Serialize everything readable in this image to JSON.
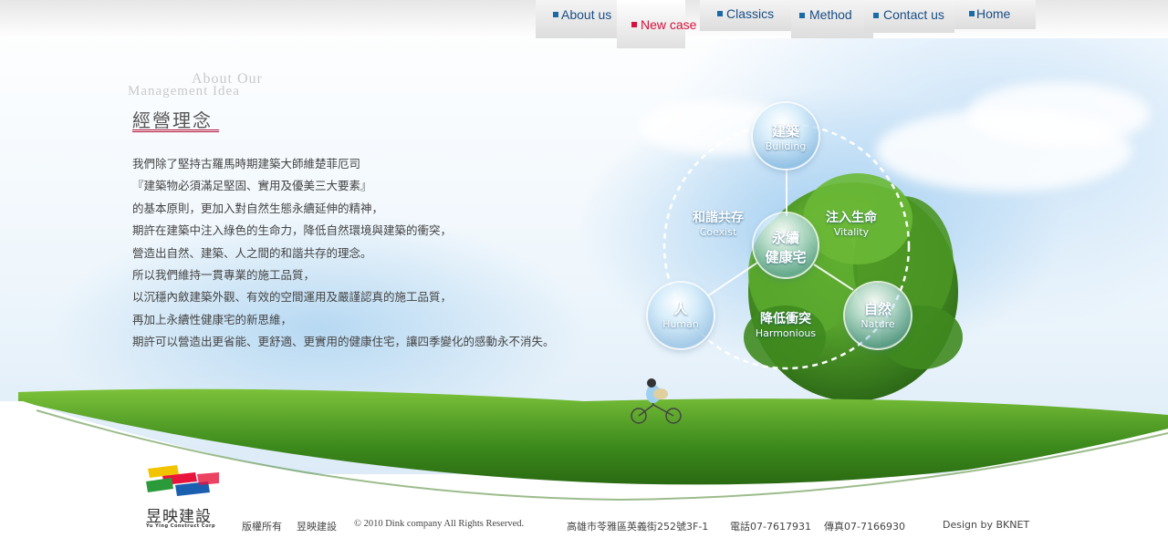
{
  "nav": {
    "items": [
      {
        "label": "About us",
        "active": false
      },
      {
        "label": "New case",
        "active": true
      },
      {
        "label": "Classics",
        "active": false
      },
      {
        "label": "Method",
        "active": false
      },
      {
        "label": "Contact us",
        "active": false
      },
      {
        "label": "Home",
        "active": false
      }
    ],
    "accent_color": "#1a6aa8",
    "active_color": "#d8103a"
  },
  "section": {
    "heading_en_line1": "About Our",
    "heading_en_line2": "Management Idea",
    "heading_zh": "經營理念"
  },
  "body": {
    "lines": [
      "我們除了堅持古羅馬時期建築大師維楚菲厄司",
      "『建築物必須滿足堅固、實用及優美三大要素』",
      "的基本原則，更加入對自然生態永續延伸的精神，",
      "期許在建築中注入綠色的生命力，降低自然環境與建築的衝突，",
      "營造出自然、建築、人之間的和諧共存的理念。",
      "所以我們維持一貫專業的施工品質，",
      "以沉穩內斂建築外觀、有效的空間運用及嚴謹認真的施工品質，",
      "再加上永續性健康宅的新思維，",
      "期許可以營造出更省能、更舒適、更實用的健康住宅，讓四季變化的感動永不消失。"
    ]
  },
  "diagram": {
    "center": {
      "zh_line1": "永續",
      "zh_line2": "健康宅"
    },
    "nodes": {
      "building": {
        "zh": "建築",
        "en": "Building"
      },
      "human": {
        "zh": "人",
        "en": "Human"
      },
      "nature": {
        "zh": "自然",
        "en": "Nature"
      }
    },
    "labels": {
      "coexist": {
        "zh": "和諧共存",
        "en": "Coexist"
      },
      "vitality": {
        "zh": "注入生命",
        "en": "Vitality"
      },
      "harmonious": {
        "zh": "降低衝突",
        "en": "Harmonious"
      }
    }
  },
  "logo": {
    "name_zh": "昱映建設",
    "name_en": "Yu Ying Construct Corp"
  },
  "footer": {
    "copyright_zh": "版權所有",
    "company": "昱映建設",
    "copyright_en": "© 2010 Dink company All Rights Reserved.",
    "address": "高雄市苓雅區英義街252號3F-1",
    "phone": "電話07-7617931",
    "fax": "傳真07-7166930",
    "design": "Design by  BKNET"
  }
}
